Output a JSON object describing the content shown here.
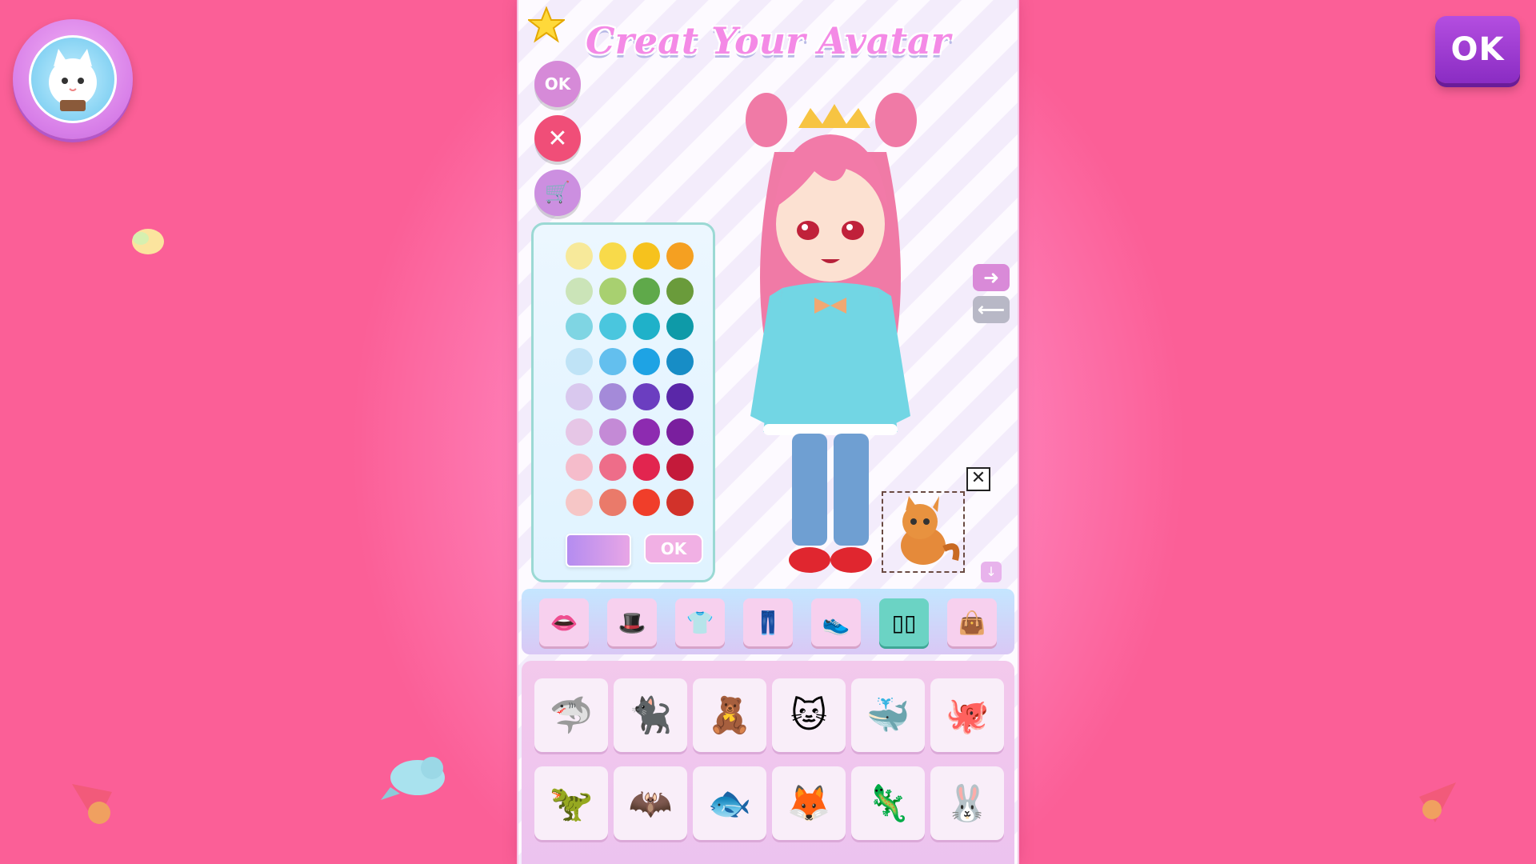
{
  "header": {
    "title": "Creat Your Avatar",
    "top_ok_label": "OK"
  },
  "side_buttons": {
    "ok_label": "OK",
    "close_label": "✕",
    "shop_label": "🛒"
  },
  "palette": {
    "colors": [
      [
        "#f7e99a",
        "#f8da4a",
        "#f6c21d",
        "#f5a021"
      ],
      [
        "#cbe4b8",
        "#a8d070",
        "#5fa94a",
        "#6a9b3b"
      ],
      [
        "#7fd5e3",
        "#4ac6de",
        "#1fb1c9",
        "#0e9aa8"
      ],
      [
        "#bfe3f6",
        "#63bfee",
        "#1ea3e4",
        "#178dc6"
      ],
      [
        "#d9c8ee",
        "#a48ad9",
        "#6b3ec0",
        "#5a27a8"
      ],
      [
        "#e6c6e6",
        "#c48ad6",
        "#8d2bb0",
        "#7a1f9e"
      ],
      [
        "#f5bccb",
        "#ee6d89",
        "#e2254f",
        "#c41a3a"
      ],
      [
        "#f6c6c6",
        "#ea7a6a",
        "#f03e2a",
        "#d2322a"
      ]
    ],
    "ok_label": "OK"
  },
  "categories": [
    {
      "name": "lips",
      "icon": "👄"
    },
    {
      "name": "hat",
      "icon": "🎩"
    },
    {
      "name": "top",
      "icon": "👕"
    },
    {
      "name": "pants",
      "icon": "👖"
    },
    {
      "name": "shoes",
      "icon": "👟"
    },
    {
      "name": "pet",
      "icon": "▯▯"
    },
    {
      "name": "bag",
      "icon": "👜"
    }
  ],
  "pets": [
    {
      "name": "shark-pet",
      "icon": "🦈"
    },
    {
      "name": "black-cat-pet",
      "icon": "🐈‍⬛"
    },
    {
      "name": "teddy-pet",
      "icon": "🧸"
    },
    {
      "name": "pink-cat-pet",
      "icon": "🐱"
    },
    {
      "name": "narwhal-pet",
      "icon": "🐳"
    },
    {
      "name": "octopus-pet",
      "icon": "🐙"
    },
    {
      "name": "dino-pet",
      "icon": "🦖"
    },
    {
      "name": "bat-cat-pet",
      "icon": "🦇"
    },
    {
      "name": "fish-pet",
      "icon": "🐟"
    },
    {
      "name": "fox-pet",
      "icon": "🦊"
    },
    {
      "name": "axolotl-pet",
      "icon": "🦎"
    },
    {
      "name": "bunny-pet",
      "icon": "🐰"
    }
  ],
  "colors": {
    "accent": "#9a3ad0",
    "background": "#fb6a9f",
    "active_category": "#6bd3c4"
  }
}
